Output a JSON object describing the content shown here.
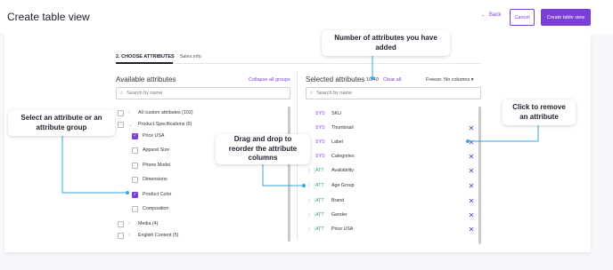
{
  "header": {
    "title": "Create table view",
    "back_label": "Back",
    "cancel_label": "Cancel",
    "create_label": "Create table view"
  },
  "steps": {
    "active": "2. CHOOSE ATTRIBUTES",
    "inactive": "Sales info"
  },
  "available": {
    "title": "Available attributes",
    "collapse_label": "Collapse all groups",
    "search_placeholder": "Search by name",
    "items": [
      {
        "label": "All custom attributes (102)",
        "checked": false
      },
      {
        "label": "Product Specifications (6)",
        "checked": false
      },
      {
        "label": "Price USA",
        "checked": true
      },
      {
        "label": "Apparel Size",
        "checked": false
      },
      {
        "label": "Phone Model",
        "checked": false
      },
      {
        "label": "Dimensions",
        "checked": false
      },
      {
        "label": "Product Color",
        "checked": true
      },
      {
        "label": "Composition",
        "checked": false
      },
      {
        "label": "Media (4)",
        "checked": false
      },
      {
        "label": "English Content (5)",
        "checked": false
      }
    ]
  },
  "selected": {
    "title": "Selected attributes",
    "count": "10/40",
    "clear_label": "Clear all",
    "freeze_label": "Freeze: No columns",
    "search_placeholder": "Search by name",
    "items": [
      {
        "tag": "SYS",
        "label": "SKU"
      },
      {
        "tag": "SYS",
        "label": "Thumbnail"
      },
      {
        "tag": "SYS",
        "label": "Label"
      },
      {
        "tag": "SYS",
        "label": "Categories"
      },
      {
        "tag": "ATT",
        "label": "Availability"
      },
      {
        "tag": "ATT",
        "label": "Age Group"
      },
      {
        "tag": "ATT",
        "label": "Brand"
      },
      {
        "tag": "ATT",
        "label": "Gender"
      },
      {
        "tag": "ATT",
        "label": "Price USA"
      }
    ]
  },
  "callouts": {
    "count": "Number of attributes you have added",
    "remove": "Click to remove an attribute",
    "select": "Select an attribute or an attribute group",
    "drag": "Drag and drop to reorder the attribute columns"
  },
  "colors": {
    "accent": "#7b3fd6",
    "callout_line": "#3aa7d8"
  },
  "icons": {
    "back": "arrow-left-icon",
    "search": "search-icon",
    "remove": "close-icon",
    "grip": "drag-handle-icon",
    "caret": "chevron-right-icon",
    "freeze": "caret-down-icon"
  }
}
